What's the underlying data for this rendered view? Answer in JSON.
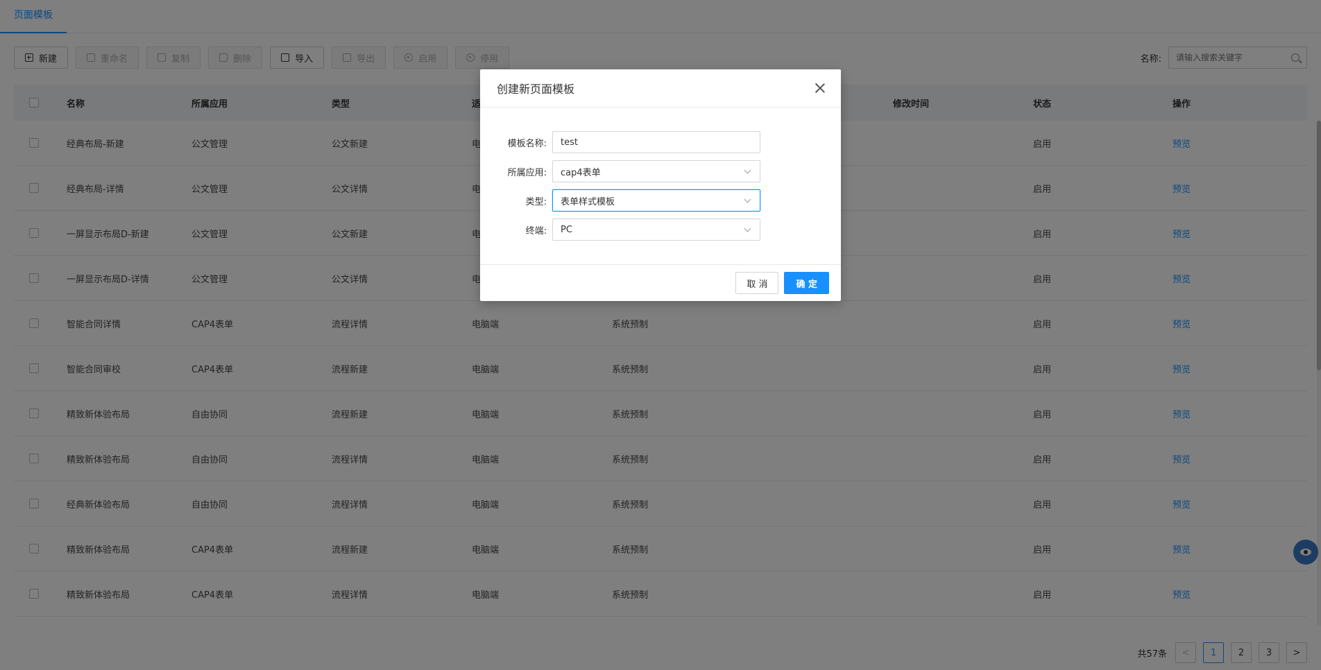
{
  "tabs": {
    "active_label": "页面模板"
  },
  "toolbar": {
    "buttons": [
      {
        "label": "新建",
        "disabled": false,
        "icon": "plus-square-icon"
      },
      {
        "label": "重命名",
        "disabled": true,
        "icon": "edit-icon"
      },
      {
        "label": "复制",
        "disabled": true,
        "icon": "copy-icon"
      },
      {
        "label": "删除",
        "disabled": true,
        "icon": "delete-icon"
      },
      {
        "label": "导入",
        "disabled": false,
        "icon": "import-icon"
      },
      {
        "label": "导出",
        "disabled": true,
        "icon": "export-icon"
      },
      {
        "label": "启用",
        "disabled": true,
        "icon": "enable-icon"
      },
      {
        "label": "停用",
        "disabled": true,
        "icon": "disable-icon"
      }
    ]
  },
  "search": {
    "label": "名称:",
    "placeholder": "请输入搜索关键字"
  },
  "table": {
    "headers": {
      "name": "名称",
      "app": "所属应用",
      "type": "类型",
      "terminal": "适",
      "mtime": "修改时间",
      "status": "状态",
      "op": "操作"
    },
    "rows": [
      {
        "name": "经典布局-新建",
        "app": "公文管理",
        "type": "公文新建",
        "terminal": "电",
        "source": "",
        "mtime": "",
        "status": "启用",
        "op": "预览"
      },
      {
        "name": "经典布局-详情",
        "app": "公文管理",
        "type": "公文详情",
        "terminal": "电",
        "source": "",
        "mtime": "",
        "status": "启用",
        "op": "预览"
      },
      {
        "name": "一屏显示布局D-新建",
        "app": "公文管理",
        "type": "公文新建",
        "terminal": "电",
        "source": "",
        "mtime": "",
        "status": "启用",
        "op": "预览"
      },
      {
        "name": "一屏显示布局D-详情",
        "app": "公文管理",
        "type": "公文详情",
        "terminal": "电",
        "source": "",
        "mtime": "",
        "status": "启用",
        "op": "预览"
      },
      {
        "name": "智能合同详情",
        "app": "CAP4表单",
        "type": "流程详情",
        "terminal": "电脑端",
        "source": "系统预制",
        "mtime": "",
        "status": "启用",
        "op": "预览"
      },
      {
        "name": "智能合同审校",
        "app": "CAP4表单",
        "type": "流程新建",
        "terminal": "电脑端",
        "source": "系统预制",
        "mtime": "",
        "status": "启用",
        "op": "预览"
      },
      {
        "name": "精致新体验布局",
        "app": "自由协同",
        "type": "流程新建",
        "terminal": "电脑端",
        "source": "系统预制",
        "mtime": "",
        "status": "启用",
        "op": "预览"
      },
      {
        "name": "精致新体验布局",
        "app": "自由协同",
        "type": "流程详情",
        "terminal": "电脑端",
        "source": "系统预制",
        "mtime": "",
        "status": "启用",
        "op": "预览"
      },
      {
        "name": "经典新体验布局",
        "app": "自由协同",
        "type": "流程详情",
        "terminal": "电脑端",
        "source": "系统预制",
        "mtime": "",
        "status": "启用",
        "op": "预览"
      },
      {
        "name": "精致新体验布局",
        "app": "CAP4表单",
        "type": "流程新建",
        "terminal": "电脑端",
        "source": "系统预制",
        "mtime": "",
        "status": "启用",
        "op": "预览"
      },
      {
        "name": "精致新体验布局",
        "app": "CAP4表单",
        "type": "流程详情",
        "terminal": "电脑端",
        "source": "系统预制",
        "mtime": "",
        "status": "启用",
        "op": "预览"
      }
    ]
  },
  "pagination": {
    "total": "共57条",
    "prev": "<",
    "pages": [
      "1",
      "2",
      "3"
    ],
    "current": "1",
    "next": ">"
  },
  "dialog": {
    "title": "创建新页面模板",
    "fields": {
      "name": {
        "label": "模板名称:",
        "value": "test"
      },
      "app": {
        "label": "所属应用:",
        "value": "cap4表单"
      },
      "type": {
        "label": "类型:",
        "value": "表单样式模板"
      },
      "terminal": {
        "label": "终端:",
        "value": "PC"
      }
    },
    "cancel_label": "取 消",
    "ok_label": "确 定"
  },
  "colors": {
    "accent": "#1890ff",
    "overlay": "rgba(0,0,0,0.5)"
  }
}
